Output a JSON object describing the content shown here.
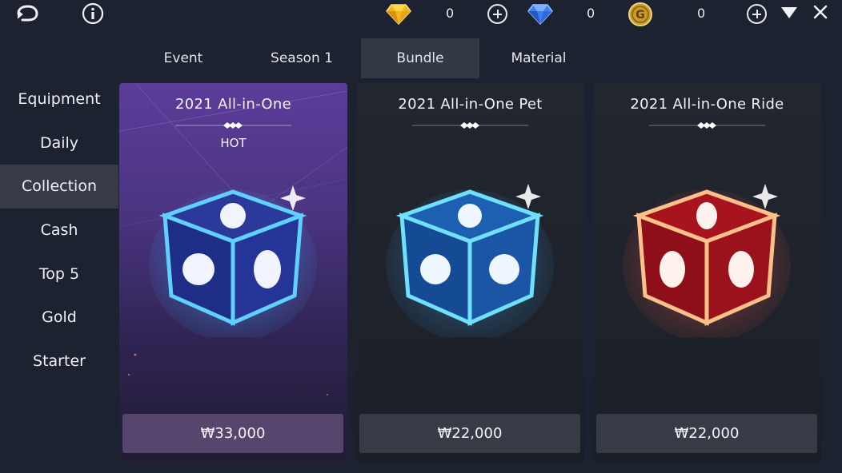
{
  "topbar": {
    "back_icon": "back-arrow-icon",
    "info_icon": "info-icon",
    "currencies": [
      {
        "name": "gold-gem",
        "icon": "yellow-gem-icon",
        "amount": "0",
        "color": "#f2b51d"
      },
      {
        "name": "blue-gem",
        "icon": "blue-gem-icon",
        "amount": "0",
        "color": "#3f7ff0"
      },
      {
        "name": "gold-coin",
        "icon": "gold-coin-icon",
        "amount": "0",
        "color": "#c89a2a"
      }
    ],
    "dropdown_icon": "triangle-down-icon",
    "close_icon": "close-icon"
  },
  "tabs": [
    {
      "label": "Event",
      "active": false
    },
    {
      "label": "Season 1",
      "active": false
    },
    {
      "label": "Bundle",
      "active": true
    },
    {
      "label": "Material",
      "active": false
    }
  ],
  "sidebar": {
    "items": [
      {
        "label": "Equipment",
        "active": false
      },
      {
        "label": "Daily",
        "active": false
      },
      {
        "label": "Collection",
        "active": true
      },
      {
        "label": "Cash",
        "active": false
      },
      {
        "label": "Top 5",
        "active": false
      },
      {
        "label": "Gold",
        "active": false
      },
      {
        "label": "Starter",
        "active": false
      }
    ]
  },
  "products": [
    {
      "title": "2021 All-in-One",
      "badge": "HOT",
      "price": "₩33,000",
      "box_color": "blue"
    },
    {
      "title": "2021 All-in-One Pet",
      "badge": "",
      "price": "₩22,000",
      "box_color": "blue"
    },
    {
      "title": "2021 All-in-One Ride",
      "badge": "",
      "price": "₩22,000",
      "box_color": "red"
    }
  ],
  "colors": {
    "background": "#1d2230",
    "box_blue": "#3aa8ff",
    "box_red": "#ff5a4a"
  }
}
